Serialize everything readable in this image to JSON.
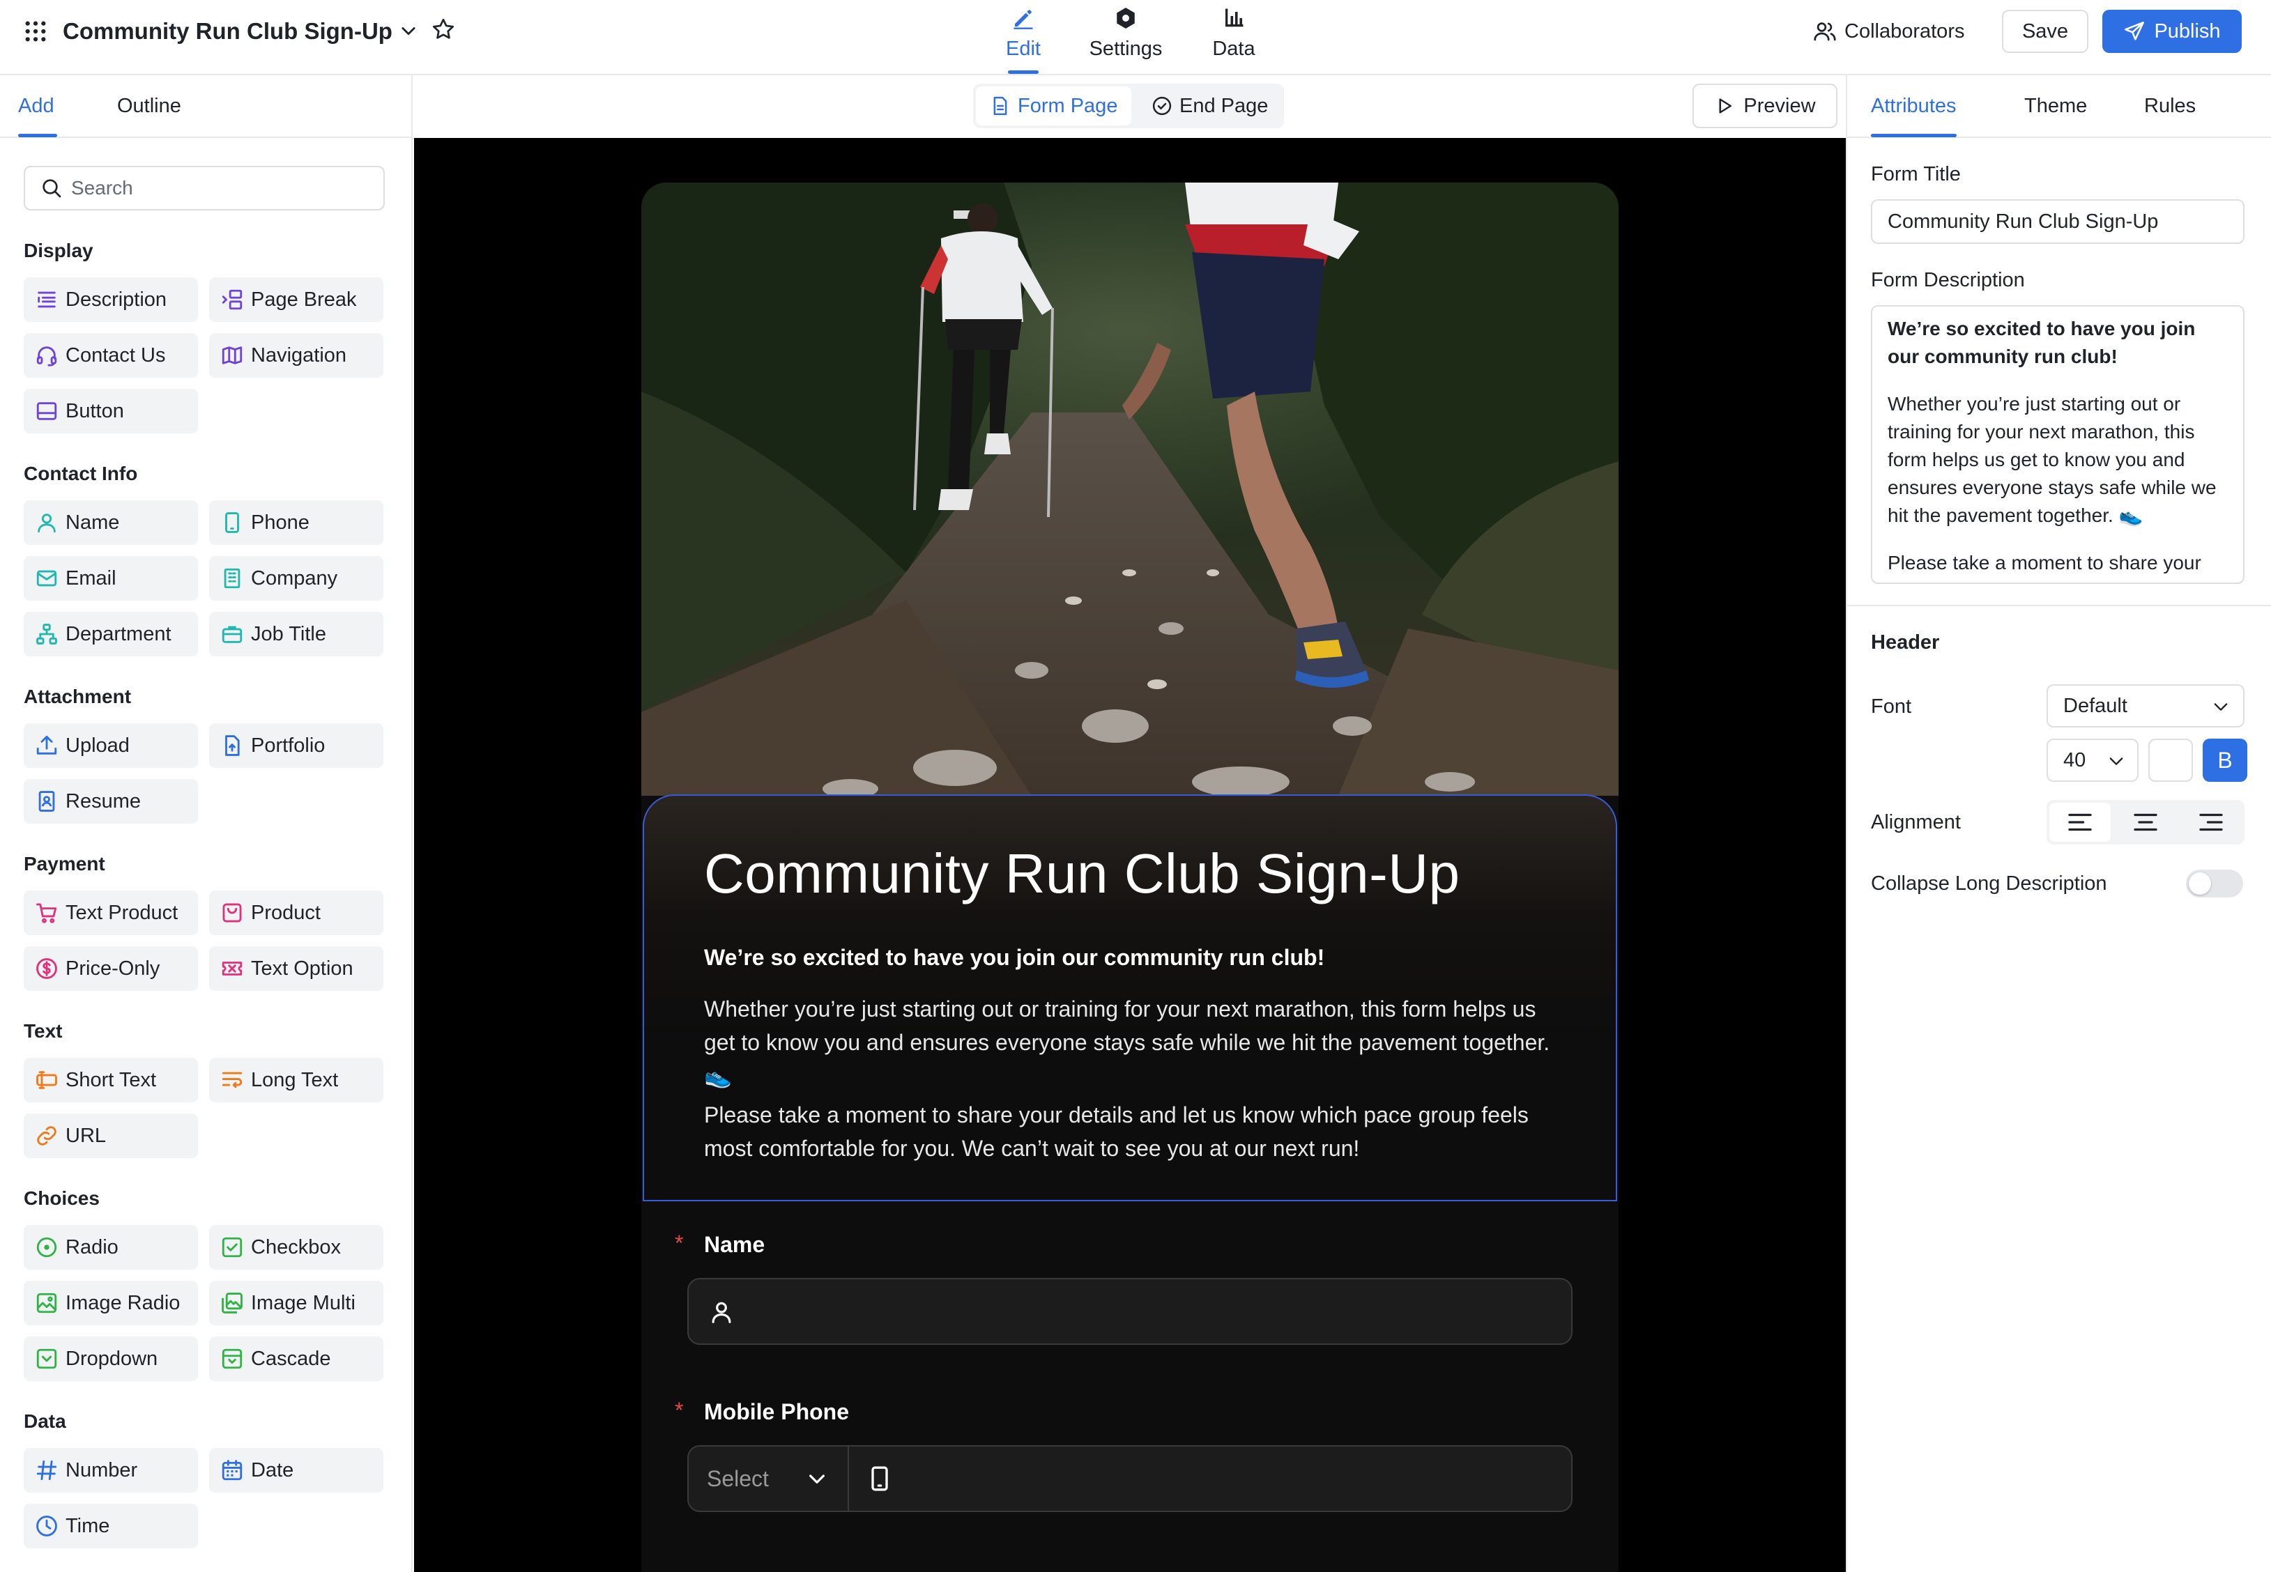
{
  "topbar": {
    "title": "Community Run Club Sign-Up",
    "modes": [
      {
        "label": "Edit",
        "icon": "pencil-icon",
        "active": true
      },
      {
        "label": "Settings",
        "icon": "gear-icon",
        "active": false
      },
      {
        "label": "Data",
        "icon": "bar-chart-icon",
        "active": false
      }
    ],
    "collaborators_label": "Collaborators",
    "save_label": "Save",
    "publish_label": "Publish"
  },
  "left_panel": {
    "tabs": [
      {
        "label": "Add",
        "active": true
      },
      {
        "label": "Outline",
        "active": false
      }
    ],
    "search_placeholder": "Search",
    "sections": [
      {
        "title": "Display",
        "items": [
          {
            "label": "Description",
            "icon": "description-icon"
          },
          {
            "label": "Page Break",
            "icon": "page-break-icon"
          },
          {
            "label": "Contact Us",
            "icon": "headset-icon"
          },
          {
            "label": "Navigation",
            "icon": "map-icon"
          },
          {
            "label": "Button",
            "icon": "button-icon"
          }
        ]
      },
      {
        "title": "Contact Info",
        "items": [
          {
            "label": "Name",
            "icon": "user-icon"
          },
          {
            "label": "Phone",
            "icon": "phone-icon"
          },
          {
            "label": "Email",
            "icon": "mail-icon"
          },
          {
            "label": "Company",
            "icon": "building-icon"
          },
          {
            "label": "Department",
            "icon": "org-chart-icon"
          },
          {
            "label": "Job Title",
            "icon": "briefcase-icon"
          }
        ]
      },
      {
        "title": "Attachment",
        "items": [
          {
            "label": "Upload",
            "icon": "upload-icon"
          },
          {
            "label": "Portfolio",
            "icon": "file-upload-icon"
          },
          {
            "label": "Resume",
            "icon": "resume-icon"
          }
        ]
      },
      {
        "title": "Payment",
        "items": [
          {
            "label": "Text Product",
            "icon": "cart-icon"
          },
          {
            "label": "Product",
            "icon": "bag-icon"
          },
          {
            "label": "Price-Only",
            "icon": "dollar-icon"
          },
          {
            "label": "Text Option",
            "icon": "ticket-icon"
          }
        ]
      },
      {
        "title": "Text",
        "items": [
          {
            "label": "Short Text",
            "icon": "short-text-icon"
          },
          {
            "label": "Long Text",
            "icon": "long-text-icon"
          },
          {
            "label": "URL",
            "icon": "link-icon"
          }
        ]
      },
      {
        "title": "Choices",
        "items": [
          {
            "label": "Radio",
            "icon": "radio-icon"
          },
          {
            "label": "Checkbox",
            "icon": "checkbox-icon"
          },
          {
            "label": "Image Radio",
            "icon": "image-radio-icon"
          },
          {
            "label": "Image Multi",
            "icon": "image-multi-icon"
          },
          {
            "label": "Dropdown",
            "icon": "dropdown-icon"
          },
          {
            "label": "Cascade",
            "icon": "cascade-icon"
          }
        ]
      },
      {
        "title": "Data",
        "items": [
          {
            "label": "Number",
            "icon": "hash-icon"
          },
          {
            "label": "Date",
            "icon": "calendar-icon"
          },
          {
            "label": "Time",
            "icon": "clock-icon"
          }
        ]
      }
    ]
  },
  "canvas": {
    "page_tabs": [
      {
        "label": "Form Page",
        "active": true
      },
      {
        "label": "End Page",
        "active": false
      }
    ],
    "preview_label": "Preview",
    "form": {
      "title": "Community Run Club Sign-Up",
      "intro_bold": "We’re so excited to have you join our community run club!",
      "para1": "Whether you’re just starting out or training for your next marathon, this form helps us get to know you and ensures everyone stays safe while we hit the pavement together. 👟",
      "para2": "Please take a moment to share your details and let us know which pace group feels most comfortable for you. We can’t wait to see you at our next run!",
      "fields": [
        {
          "label": "Name",
          "required_mark": "*"
        },
        {
          "label": "Mobile Phone",
          "required_mark": "*",
          "select_placeholder": "Select"
        }
      ]
    }
  },
  "right_panel": {
    "tabs": [
      {
        "label": "Attributes",
        "active": true
      },
      {
        "label": "Theme",
        "active": false
      },
      {
        "label": "Rules",
        "active": false
      }
    ],
    "form_title_label": "Form Title",
    "form_title_value": "Community Run Club Sign-Up",
    "form_description_label": "Form Description",
    "description_bold": "We’re so excited to have you join our community run club!",
    "description_p1": "Whether you’re just starting out or training for your next marathon, this form helps us get to know you and ensures everyone stays safe while we hit the pavement together. 👟",
    "description_p2": "Please take a moment to share your details and let us know which pace group feels most comfortable for you. We can’t wait to see you at our next run!",
    "header_section": "Header",
    "font_label": "Font",
    "font_value": "Default",
    "size_value": "40",
    "bold_label": "B",
    "alignment_label": "Alignment",
    "collapse_label": "Collapse Long Description",
    "collapse_on": false
  },
  "colors": {
    "accent": "#2f6fe4",
    "header_border": "#3a5bd9",
    "required": "#e5484d"
  }
}
